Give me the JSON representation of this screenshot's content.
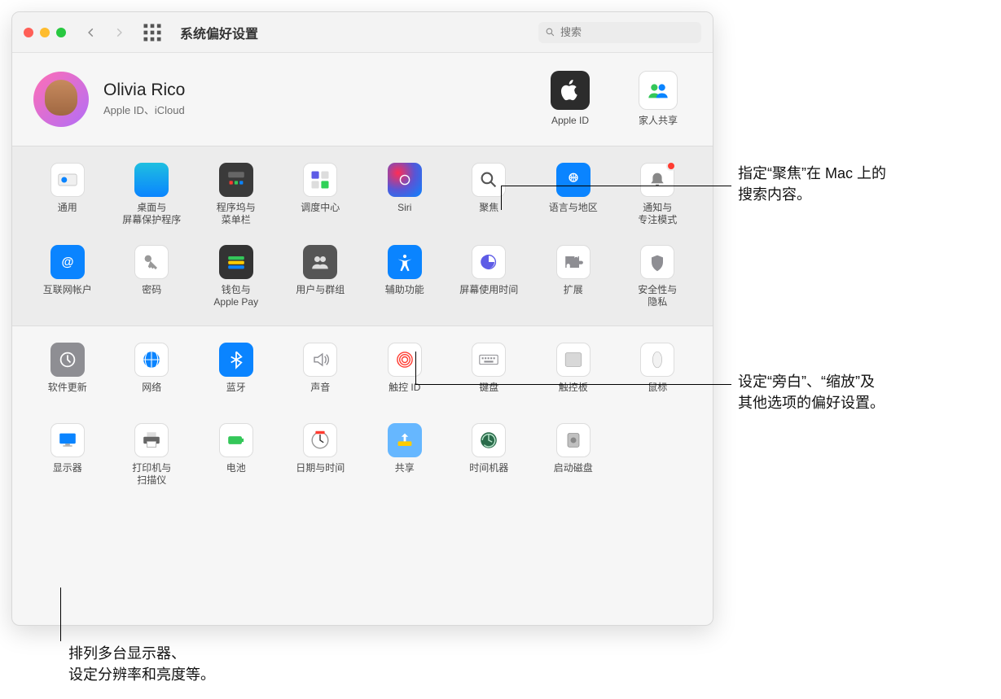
{
  "window_title": "系统偏好设置",
  "search": {
    "placeholder": "搜索"
  },
  "account": {
    "name": "Olivia Rico",
    "subtitle": "Apple ID、iCloud"
  },
  "account_buttons": {
    "apple_id": "Apple ID",
    "family": "家人共享"
  },
  "section1": [
    {
      "id": "general",
      "label": "通用"
    },
    {
      "id": "desktop",
      "label": "桌面与\n屏幕保护程序"
    },
    {
      "id": "dock",
      "label": "程序坞与\n菜单栏"
    },
    {
      "id": "mission",
      "label": "调度中心"
    },
    {
      "id": "siri",
      "label": "Siri"
    },
    {
      "id": "spotlight",
      "label": "聚焦"
    },
    {
      "id": "language",
      "label": "语言与地区"
    },
    {
      "id": "notify",
      "label": "通知与\n专注模式",
      "badge": true
    },
    {
      "id": "internet",
      "label": "互联网帐户"
    },
    {
      "id": "passwords",
      "label": "密码"
    },
    {
      "id": "wallet",
      "label": "钱包与\nApple Pay"
    },
    {
      "id": "users",
      "label": "用户与群组"
    },
    {
      "id": "a11y",
      "label": "辅助功能"
    },
    {
      "id": "screentime",
      "label": "屏幕使用时间"
    },
    {
      "id": "extensions",
      "label": "扩展"
    },
    {
      "id": "security",
      "label": "安全性与\n隐私"
    }
  ],
  "section2": [
    {
      "id": "update",
      "label": "软件更新"
    },
    {
      "id": "network",
      "label": "网络"
    },
    {
      "id": "bluetooth",
      "label": "蓝牙"
    },
    {
      "id": "sound",
      "label": "声音"
    },
    {
      "id": "touchid",
      "label": "触控 ID"
    },
    {
      "id": "keyboard",
      "label": "键盘"
    },
    {
      "id": "trackpad",
      "label": "触控板"
    },
    {
      "id": "mouse",
      "label": "鼠标"
    },
    {
      "id": "displays",
      "label": "显示器"
    },
    {
      "id": "printers",
      "label": "打印机与\n扫描仪"
    },
    {
      "id": "battery",
      "label": "电池"
    },
    {
      "id": "datetime",
      "label": "日期与时间"
    },
    {
      "id": "sharing",
      "label": "共享"
    },
    {
      "id": "timemachine",
      "label": "时间机器"
    },
    {
      "id": "startup",
      "label": "启动磁盘"
    }
  ],
  "callouts": {
    "spotlight": "指定“聚焦”在 Mac 上的\n搜索内容。",
    "a11y": "设定“旁白”、“缩放”及\n其他选项的偏好设置。",
    "displays": "排列多台显示器、\n设定分辨率和亮度等。"
  }
}
